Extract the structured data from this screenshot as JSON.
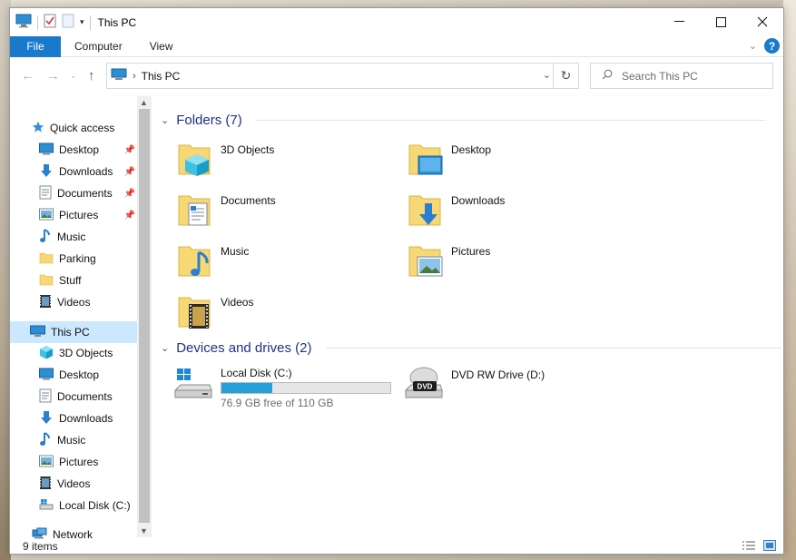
{
  "window": {
    "title": "This PC"
  },
  "ribbon": {
    "tabs": [
      "File",
      "Computer",
      "View"
    ]
  },
  "address": {
    "path": "This PC"
  },
  "search": {
    "placeholder": "Search This PC"
  },
  "nav": {
    "quick_access": "Quick access",
    "quick_items": [
      {
        "label": "Desktop",
        "icon": "desktop-icon",
        "pinned": true
      },
      {
        "label": "Downloads",
        "icon": "download-icon",
        "pinned": true
      },
      {
        "label": "Documents",
        "icon": "document-icon",
        "pinned": true
      },
      {
        "label": "Pictures",
        "icon": "pictures-icon",
        "pinned": true
      },
      {
        "label": "Music",
        "icon": "music-icon",
        "pinned": false
      },
      {
        "label": "Parking",
        "icon": "folder-icon",
        "pinned": false
      },
      {
        "label": "Stuff",
        "icon": "folder-icon",
        "pinned": false
      },
      {
        "label": "Videos",
        "icon": "video-icon",
        "pinned": false
      }
    ],
    "this_pc": "This PC",
    "pc_items": [
      {
        "label": "3D Objects",
        "icon": "cube-icon"
      },
      {
        "label": "Desktop",
        "icon": "desktop-icon"
      },
      {
        "label": "Documents",
        "icon": "document-icon"
      },
      {
        "label": "Downloads",
        "icon": "download-icon"
      },
      {
        "label": "Music",
        "icon": "music-icon"
      },
      {
        "label": "Pictures",
        "icon": "pictures-icon"
      },
      {
        "label": "Videos",
        "icon": "video-icon"
      },
      {
        "label": "Local Disk (C:)",
        "icon": "drive-icon"
      }
    ],
    "network": "Network"
  },
  "content": {
    "folders_header": "Folders (7)",
    "folders": [
      {
        "label": "3D Objects",
        "icon": "cube-folder-icon"
      },
      {
        "label": "Desktop",
        "icon": "desktop-folder-icon"
      },
      {
        "label": "Documents",
        "icon": "document-folder-icon"
      },
      {
        "label": "Downloads",
        "icon": "download-folder-icon"
      },
      {
        "label": "Music",
        "icon": "music-folder-icon"
      },
      {
        "label": "Pictures",
        "icon": "pictures-folder-icon"
      },
      {
        "label": "Videos",
        "icon": "video-folder-icon"
      }
    ],
    "drives_header": "Devices and drives (2)",
    "drives": [
      {
        "label": "Local Disk (C:)",
        "free_text": "76.9 GB free of 110 GB",
        "used_fraction": 0.3
      },
      {
        "label": "DVD RW Drive (D:)"
      }
    ]
  },
  "status": {
    "items": "9 items"
  },
  "colors": {
    "accent": "#1979ca",
    "header_text": "#1e3287",
    "selection": "#cce8ff",
    "bar_fill": "#26a0da",
    "folder": "#f8d775"
  }
}
